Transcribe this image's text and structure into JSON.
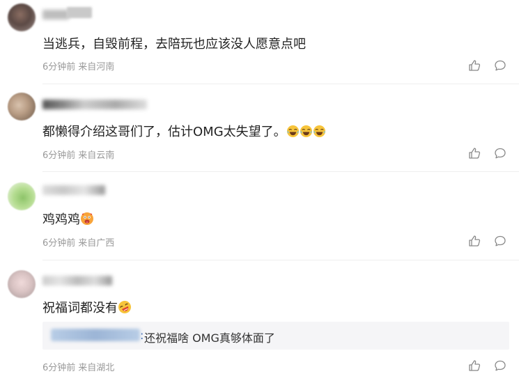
{
  "comments": [
    {
      "text": "当逃兵，自毁前程，去陪玩也应该没人愿意点吧",
      "time": "6分钟前",
      "location": "来自河南"
    },
    {
      "text": "都懒得介绍这哥们了，估计OMG太失望了。",
      "time": "6分钟前",
      "location": "来自云南",
      "emoji_icons": [
        "laugh-cry-icon",
        "laugh-cry-icon",
        "laugh-cry-icon"
      ]
    },
    {
      "text": "鸡鸡鸡",
      "time": "6分钟前",
      "location": "来自广西",
      "emoji_icons": [
        "hot-face-icon"
      ]
    },
    {
      "text": "祝福词都没有",
      "time": "6分钟前",
      "location": "来自湖北",
      "emoji_icons": [
        "rofl-icon"
      ],
      "reply": {
        "text": "还祝福啥 OMG真够体面了"
      }
    }
  ],
  "icons": {
    "like": "thumbs-up-icon",
    "reply": "comment-bubble-icon"
  },
  "colors": {
    "meta": "#999999",
    "reply_author": "#4a72b6",
    "reply_bg": "#f5f5f7",
    "divider": "#eeeeee"
  }
}
